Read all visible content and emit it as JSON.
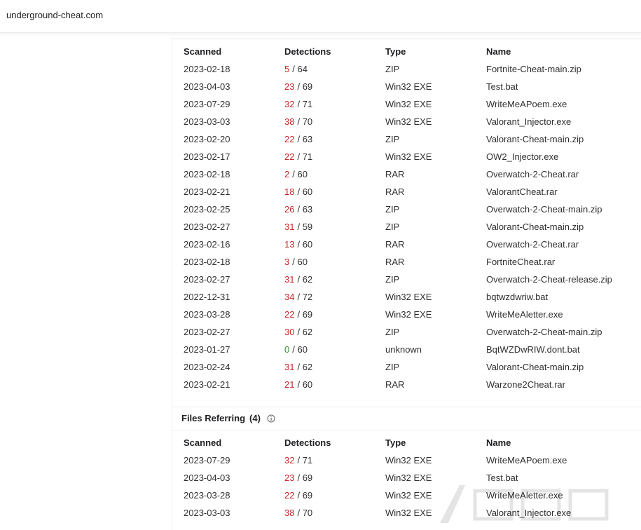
{
  "header": {
    "domain": "underground-cheat.com"
  },
  "columns": {
    "scanned": "Scanned",
    "detections": "Detections",
    "type": "Type",
    "name": "Name"
  },
  "files_downloaded": [
    {
      "scanned": "2023-02-18",
      "det": "5",
      "total": "/ 64",
      "type": "ZIP",
      "name": "Fortnite-Cheat-main.zip"
    },
    {
      "scanned": "2023-04-03",
      "det": "23",
      "total": "/ 69",
      "type": "Win32 EXE",
      "name": "Test.bat"
    },
    {
      "scanned": "2023-07-29",
      "det": "32",
      "total": "/ 71",
      "type": "Win32 EXE",
      "name": "WriteMeAPoem.exe"
    },
    {
      "scanned": "2023-03-03",
      "det": "38",
      "total": "/ 70",
      "type": "Win32 EXE",
      "name": "Valorant_Injector.exe"
    },
    {
      "scanned": "2023-02-20",
      "det": "22",
      "total": "/ 63",
      "type": "ZIP",
      "name": "Valorant-Cheat-main.zip"
    },
    {
      "scanned": "2023-02-17",
      "det": "22",
      "total": "/ 71",
      "type": "Win32 EXE",
      "name": "OW2_Injector.exe"
    },
    {
      "scanned": "2023-02-18",
      "det": "2",
      "total": "/ 60",
      "type": "RAR",
      "name": "Overwatch-2-Cheat.rar"
    },
    {
      "scanned": "2023-02-21",
      "det": "18",
      "total": "/ 60",
      "type": "RAR",
      "name": "ValorantCheat.rar"
    },
    {
      "scanned": "2023-02-25",
      "det": "26",
      "total": "/ 63",
      "type": "ZIP",
      "name": "Overwatch-2-Cheat-main.zip"
    },
    {
      "scanned": "2023-02-27",
      "det": "31",
      "total": "/ 59",
      "type": "ZIP",
      "name": "Valorant-Cheat-main.zip"
    },
    {
      "scanned": "2023-02-16",
      "det": "13",
      "total": "/ 60",
      "type": "RAR",
      "name": "Overwatch-2-Cheat.rar"
    },
    {
      "scanned": "2023-02-18",
      "det": "3",
      "total": "/ 60",
      "type": "RAR",
      "name": "FortniteCheat.rar"
    },
    {
      "scanned": "2023-02-27",
      "det": "31",
      "total": "/ 62",
      "type": "ZIP",
      "name": "Overwatch-2-Cheat-release.zip"
    },
    {
      "scanned": "2022-12-31",
      "det": "34",
      "total": "/ 72",
      "type": "Win32 EXE",
      "name": "bqtwzdwriw.bat"
    },
    {
      "scanned": "2023-03-28",
      "det": "22",
      "total": "/ 69",
      "type": "Win32 EXE",
      "name": "WriteMeAletter.exe"
    },
    {
      "scanned": "2023-02-27",
      "det": "30",
      "total": "/ 62",
      "type": "ZIP",
      "name": "Overwatch-2-Cheat-main.zip"
    },
    {
      "scanned": "2023-01-27",
      "det": "0",
      "total": "/ 60",
      "type": "unknown",
      "name": "BqtWZDwRIW.dont.bat"
    },
    {
      "scanned": "2023-02-24",
      "det": "31",
      "total": "/ 62",
      "type": "ZIP",
      "name": "Valorant-Cheat-main.zip"
    },
    {
      "scanned": "2023-02-21",
      "det": "21",
      "total": "/ 60",
      "type": "RAR",
      "name": "Warzone2Cheat.rar"
    }
  ],
  "files_referring": {
    "title": "Files Referring",
    "count": "(4)",
    "rows": [
      {
        "scanned": "2023-07-29",
        "det": "32",
        "total": "/ 71",
        "type": "Win32 EXE",
        "name": "WriteMeAPoem.exe"
      },
      {
        "scanned": "2023-04-03",
        "det": "23",
        "total": "/ 69",
        "type": "Win32 EXE",
        "name": "Test.bat"
      },
      {
        "scanned": "2023-03-28",
        "det": "22",
        "total": "/ 69",
        "type": "Win32 EXE",
        "name": "WriteMeAletter.exe"
      },
      {
        "scanned": "2023-03-03",
        "det": "38",
        "total": "/ 70",
        "type": "Win32 EXE",
        "name": "Valorant_Injector.exe"
      }
    ]
  },
  "colors": {
    "detection_positive": "#c62828",
    "detection_zero": "#388e3c"
  },
  "icons": {
    "info": "info-icon"
  }
}
